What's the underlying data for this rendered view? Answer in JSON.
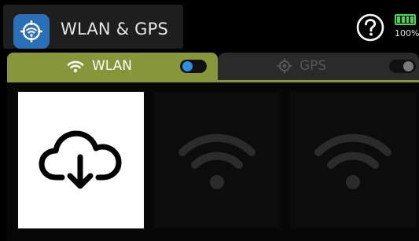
{
  "header": {
    "title": "WLAN & GPS",
    "app_icon": "wlan-gps-icon",
    "help_icon": "help-icon",
    "battery": {
      "percent_label": "100%",
      "level": 1.0,
      "color": "#3ddc4b"
    }
  },
  "tabs": [
    {
      "label": "WLAN",
      "icon": "wifi-icon",
      "active": true,
      "toggle_on": true,
      "color": "#87963a"
    },
    {
      "label": "GPS",
      "icon": "gps-target-icon",
      "active": false,
      "toggle_on": false,
      "color": "#2a2a2a"
    }
  ],
  "tiles": [
    {
      "icon": "cloud-download-icon",
      "enabled": true
    },
    {
      "icon": "wifi-icon",
      "enabled": false
    },
    {
      "icon": "wifi-icon",
      "enabled": false
    }
  ],
  "colors": {
    "accent": "#87963a",
    "app_icon_bg": "#2b6fb8",
    "toggle_on": "#2e8fe0",
    "background": "#000000"
  }
}
